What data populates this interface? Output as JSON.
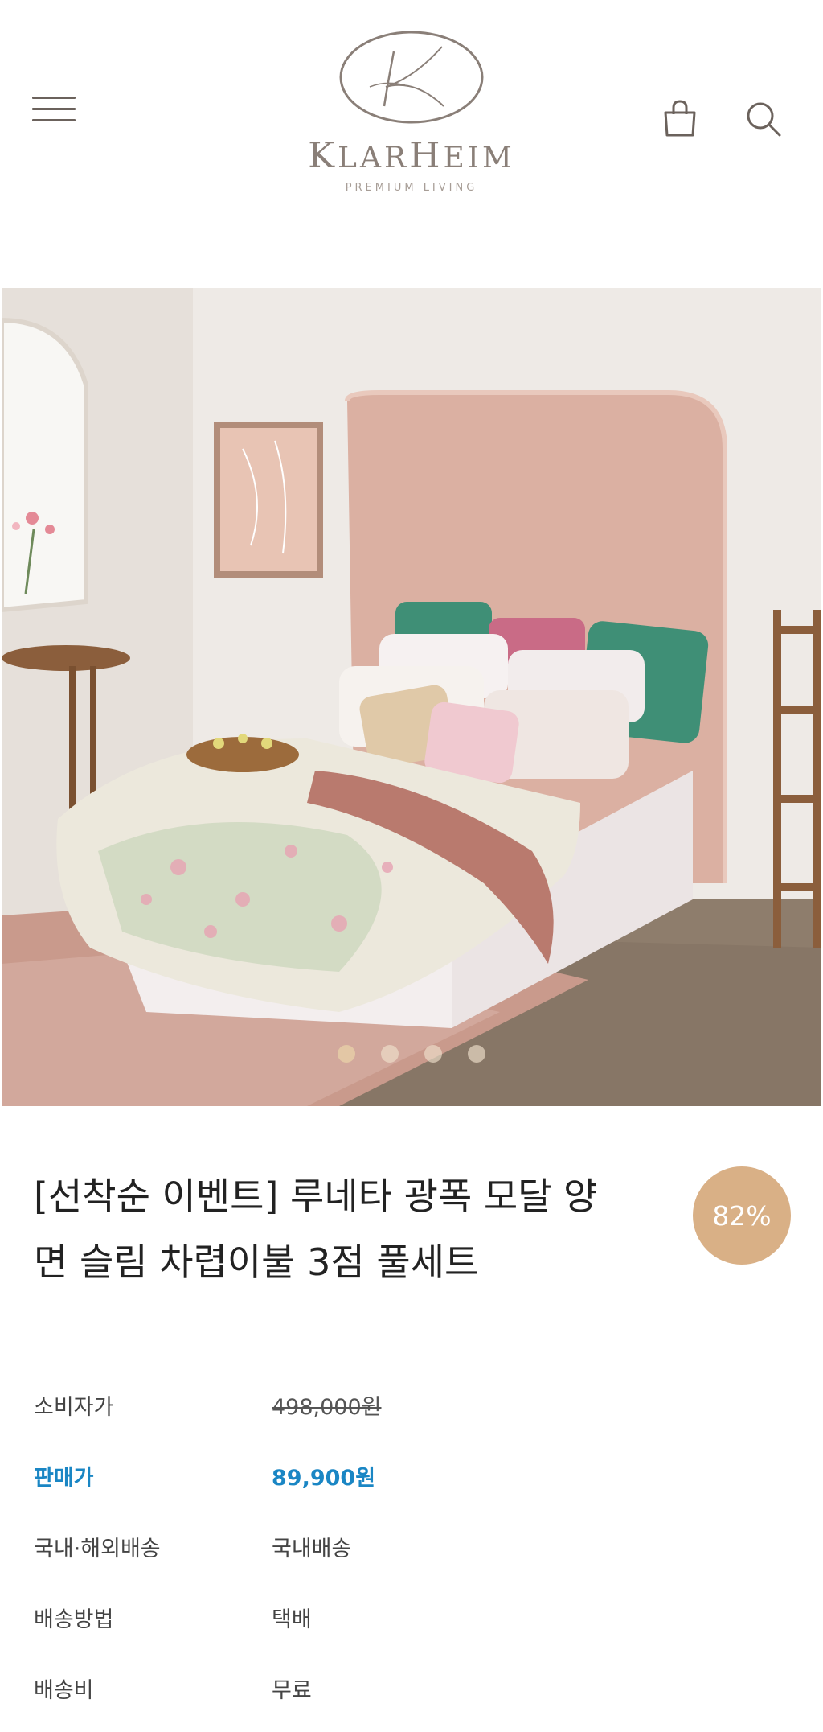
{
  "header": {
    "menu_icon": "hamburger-menu-icon",
    "cart_icon": "shopping-bag-icon",
    "search_icon": "search-icon",
    "logo": {
      "name": "KLARHEIM",
      "tagline": "PREMIUM LIVING"
    }
  },
  "gallery": {
    "slide_count": 4,
    "active_index": 0
  },
  "product": {
    "title_line1": "[선착순 이벤트] 루네타 광폭 모달 양",
    "title_line2": "면 슬림 차렵이불 3점 풀세트",
    "discount": "82%"
  },
  "info": {
    "rows": [
      {
        "label": "소비자가",
        "value": "498,000원"
      },
      {
        "label": "판매가",
        "value": "89,900원"
      },
      {
        "label": "국내·해외배송",
        "value": "국내배송"
      },
      {
        "label": "배송방법",
        "value": "택배"
      },
      {
        "label": "배송비",
        "value": "무료"
      }
    ]
  },
  "colors": {
    "accent_sale": "#1a86c4",
    "badge": "#d9b086",
    "logo": "#8a7f78"
  }
}
